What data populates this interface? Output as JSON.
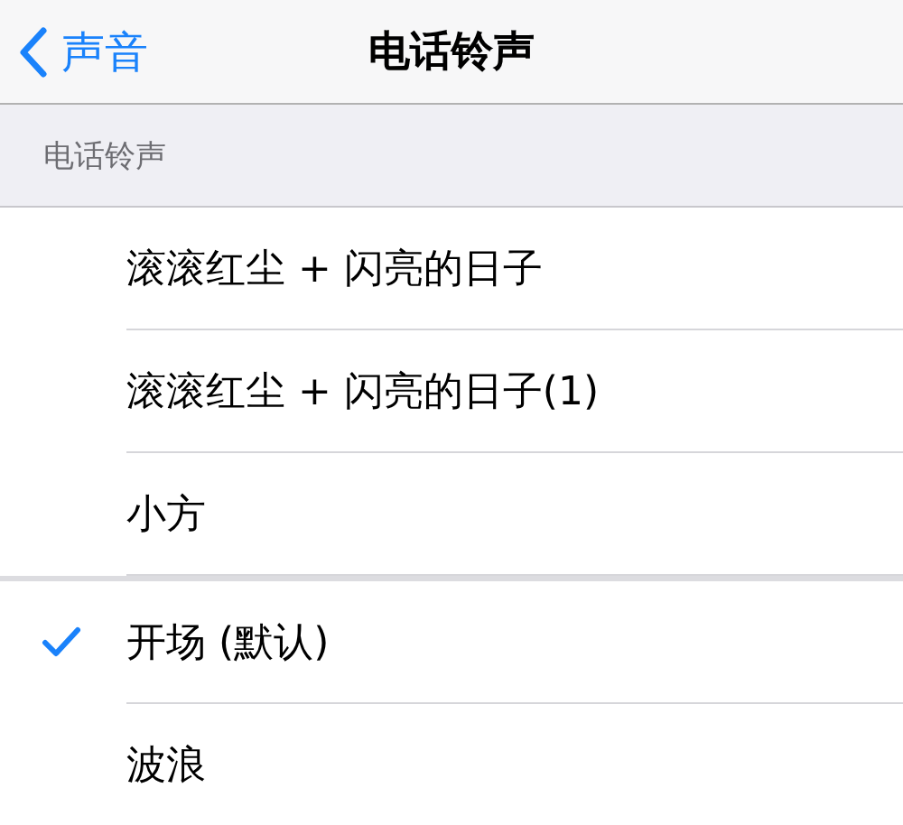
{
  "nav_bar": {
    "back_label": "声音",
    "title": "电话铃声"
  },
  "section_header": "电话铃声",
  "groups": [
    {
      "rows": [
        {
          "label": "滚滚红尘 + 闪亮的日子",
          "selected": false
        },
        {
          "label": "滚滚红尘 + 闪亮的日子(1)",
          "selected": false
        },
        {
          "label": "小方",
          "selected": false
        }
      ]
    },
    {
      "rows": [
        {
          "label": "开场 (默认)",
          "selected": true
        },
        {
          "label": "波浪",
          "selected": false
        }
      ]
    }
  ]
}
